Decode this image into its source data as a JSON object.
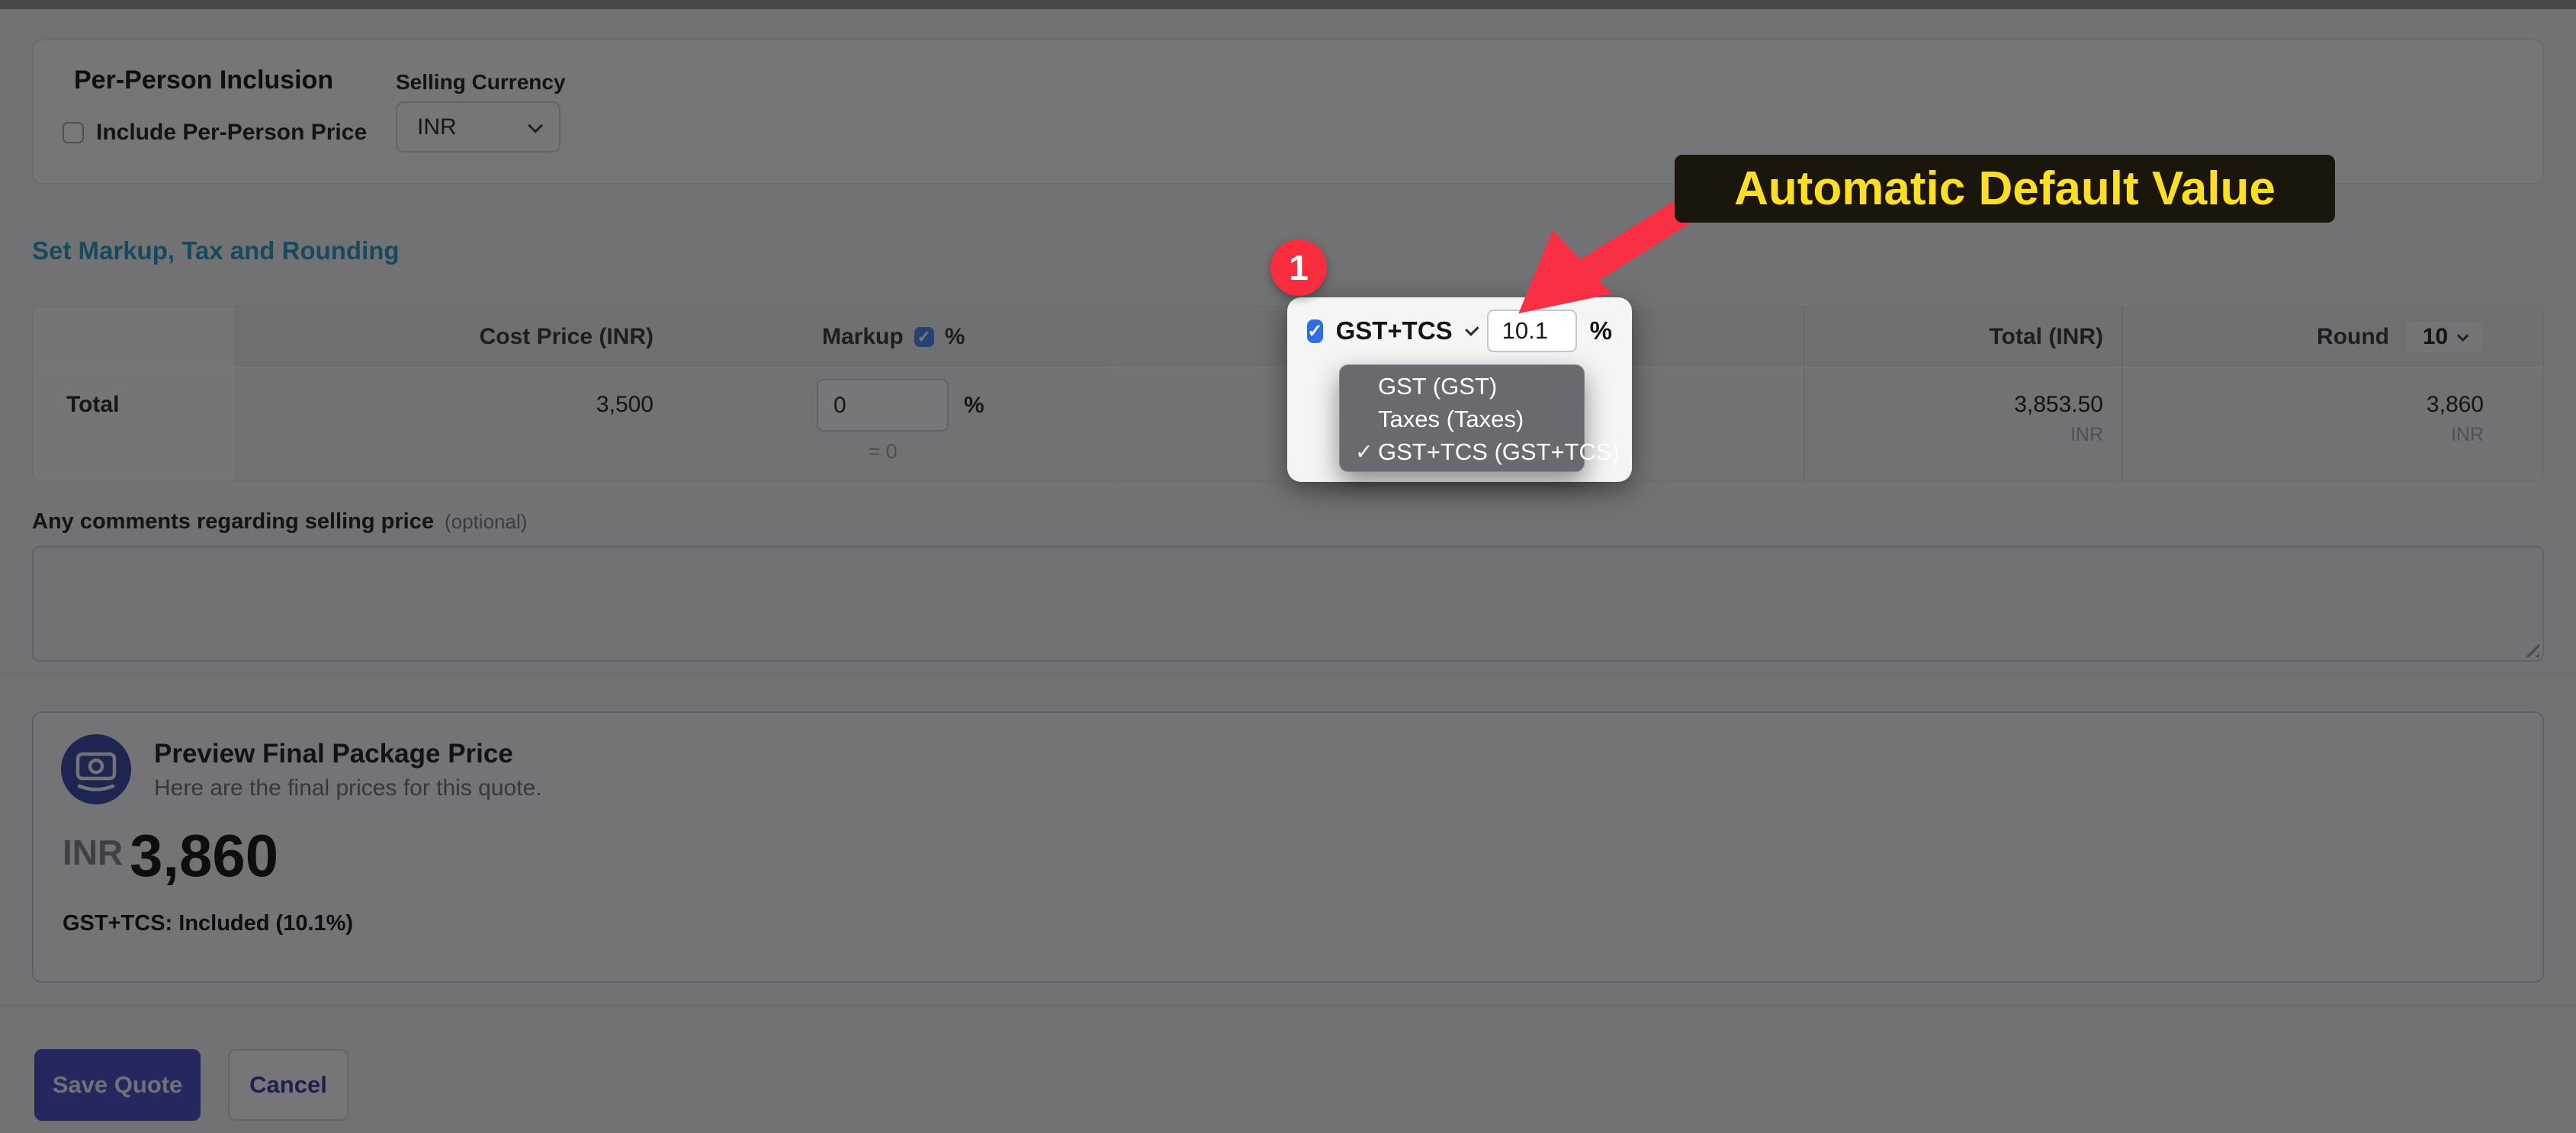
{
  "per_person": {
    "title": "Per-Person Inclusion",
    "include_checkbox_label": "Include Per-Person Price",
    "include_checked": false,
    "currency_label": "Selling Currency",
    "currency_value": "INR"
  },
  "section": {
    "heading": "Set Markup, Tax and Rounding"
  },
  "table": {
    "headers": {
      "cost": "Cost Price (INR)",
      "markup": "Markup",
      "markup_unit": "%",
      "markup_checked": true,
      "total": "Total (INR)",
      "round": "Round",
      "round_value": "10"
    },
    "row": {
      "label": "Total",
      "cost": "3,500",
      "markup_value": "0",
      "markup_unit": "%",
      "markup_result": "= 0",
      "total": "3,853.50",
      "total_currency": "INR",
      "rounded": "3,860",
      "rounded_currency": "INR"
    }
  },
  "tax_popup": {
    "checked": true,
    "selected": "GST+TCS",
    "value": "10.1",
    "unit": "%",
    "options": [
      "GST (GST)",
      "Taxes (Taxes)",
      "GST+TCS (GST+TCS)"
    ],
    "selected_option_index": 2,
    "check_glyph": "✓"
  },
  "annotations": {
    "step_number": "1",
    "callout": "Automatic Default Value",
    "arrow_color": "#f93043",
    "callout_text_color": "#ffdf20"
  },
  "comments": {
    "label": "Any comments regarding selling price",
    "optional": "(optional)",
    "value": ""
  },
  "preview": {
    "title": "Preview Final Package Price",
    "subtitle": "Here are the final prices for this quote.",
    "currency": "INR",
    "amount": "3,860",
    "tax_note": "GST+TCS: Included (10.1%)"
  },
  "actions": {
    "save": "Save Quote",
    "cancel": "Cancel"
  },
  "glyphs": {
    "check": "✓"
  },
  "colors": {
    "accent_indigo": "#4a51c7",
    "teal_heading": "#2b9cc4",
    "annotation_red": "#f92d3d",
    "annotation_yellow": "#ffdf20"
  }
}
